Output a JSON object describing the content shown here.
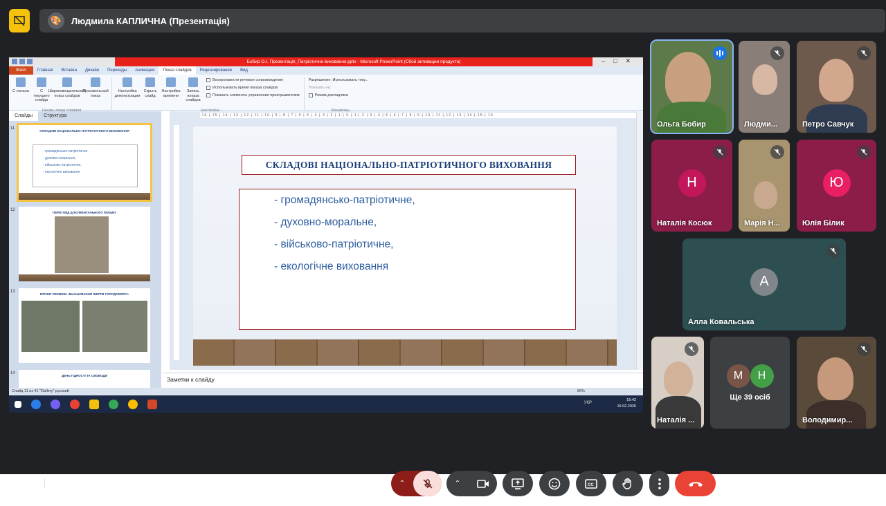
{
  "meet": {
    "presenter_title": "Людмила КАПЛИЧНА (Презентація)",
    "colors": {
      "accent": "#f4c20d",
      "end_call": "#ea4335",
      "tile": "#3c4043"
    }
  },
  "ppt": {
    "window_title": "Бобир О.І. Презентація_Патріотичне виховання.pptx  -  Microsoft PowerPoint (Сбой активации продукта)",
    "tabs": [
      "Файл",
      "Главная",
      "Вставка",
      "Дизайн",
      "Переходы",
      "Анимация",
      "Показ слайдов",
      "Рецензирование",
      "Вид"
    ],
    "ribbon": {
      "start_group": [
        "С начала",
        "С текущего слайда",
        "Широковещательный показ слайдов",
        "Произвольный показ"
      ],
      "start_group_label": "Начать показ слайдов",
      "setup_group": [
        "Настройка демонстрации",
        "Скрыть слайд",
        "Настройка времени",
        "Запись показа слайдов"
      ],
      "checks": [
        "Воспроизвести речевое сопровождение",
        "Использовать время показа слайдов",
        "Показать элементы управления проигрывателем"
      ],
      "setup_label": "Настройка",
      "monitor_items": [
        "Разрешение:",
        "Использовать теку...",
        "Показать на:",
        "Режим докладчика"
      ],
      "monitor_label": "Мониторы"
    },
    "pane_tabs": [
      "Слайды",
      "Структура"
    ],
    "thumbnails": [
      {
        "num": "11",
        "title": "СКЛАДОВІ НАЦІОНАЛЬНО-ПАТРІОТИЧНОГО ВИХОВАННЯ",
        "items": [
          "- громадянсько-патріотичне,",
          "- духовно-моральне,",
          "- військово-патріотичне,",
          "- екологічне виховання"
        ]
      },
      {
        "num": "12",
        "title": "ПЕРЕГЛЯД ДОКУМЕНТАЛЬНОГО  ФІЛЬМУ"
      },
      {
        "num": "13",
        "title": "МІТИНГ-РЕКВІЄМ «ВШАНУВАННЯ  ЖЕРТВ ГОЛОДОМОРУ»"
      },
      {
        "num": "14",
        "title": "ДЕНЬ ГІДНОСТІ ТА СВОБОДИ"
      }
    ],
    "slide": {
      "title": "СКЛАДОВІ НАЦІОНАЛЬНО-ПАТРІОТИЧНОГО ВИХОВАННЯ",
      "bullets": [
        "- громадянсько-патріотичне,",
        "- духовно-моральне,",
        "- військово-патріотичне,",
        "- екологічне  виховання"
      ]
    },
    "notes_placeholder": "Заметки к слайду",
    "status": "Слайд 11 из 41   \"Gallery\"   русский",
    "zoom": "86%",
    "tray": {
      "lang": "УКР",
      "time": "16:42",
      "date": "16.02.2026"
    }
  },
  "participants": [
    {
      "name": "Ольга Бобир",
      "speaking": true
    },
    {
      "name": "Людми...",
      "muted": true
    },
    {
      "name": "Петро Савчук",
      "muted": true
    },
    {
      "name": "Наталія Косюк",
      "initial": "Н",
      "muted": true,
      "color": "#c2185b"
    },
    {
      "name": "Марія Н...",
      "muted": true
    },
    {
      "name": "Юлія Білик",
      "initial": "Ю",
      "muted": true,
      "color": "#e91e63"
    },
    {
      "name": "Алла Ковальська",
      "initial": "А",
      "muted": true,
      "color": "#80868b"
    },
    {
      "name": "Наталія ...",
      "muted": true
    },
    {
      "name": "Володимир...",
      "muted": true
    }
  ],
  "more": {
    "label": "Ще 39 осіб",
    "initials": [
      "М",
      "Н"
    ]
  }
}
